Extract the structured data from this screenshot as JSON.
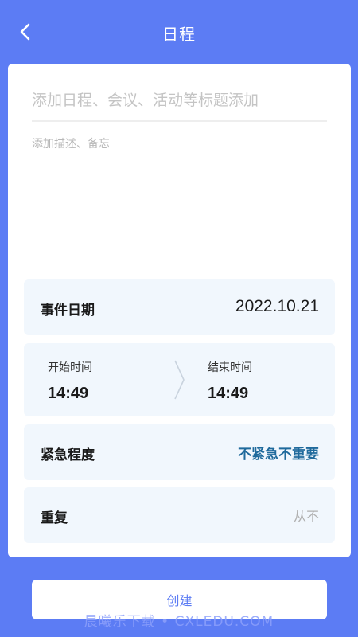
{
  "header": {
    "title": "日程",
    "back_icon": "chevron-left-icon"
  },
  "form": {
    "title_placeholder": "添加日程、会议、活动等标题添加",
    "description_placeholder": "添加描述、备忘"
  },
  "event_date": {
    "label": "事件日期",
    "value": "2022.10.21"
  },
  "time_range": {
    "start_label": "开始时间",
    "start_value": "14:49",
    "end_label": "结束时间",
    "end_value": "14:49",
    "arrow_icon": "chevron-right-icon"
  },
  "urgency": {
    "label": "紧急程度",
    "value": "不紧急不重要"
  },
  "repeat": {
    "label": "重复",
    "value": "从不"
  },
  "actions": {
    "create_label": "创建"
  },
  "watermark": {
    "text": "晨曦乐下载 • CXLEDU.COM"
  },
  "colors": {
    "background": "#5c7cf4",
    "row_background": "#f1f7fd",
    "urgency_text": "#1f6a9c",
    "create_text": "#5c7cf4"
  }
}
